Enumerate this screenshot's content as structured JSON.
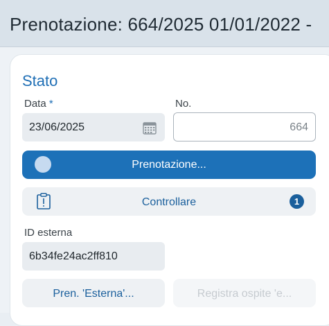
{
  "window": {
    "title": "Prenotazione: 664/2025 01/01/2022 -"
  },
  "section": {
    "title": "Stato"
  },
  "date": {
    "label": "Data",
    "required_mark": "*",
    "value": "23/06/2025",
    "icon": "calendar-icon"
  },
  "number": {
    "label": "No.",
    "value": "664"
  },
  "status_button": {
    "label": "Prenotazione..."
  },
  "check_button": {
    "label": "Controllare",
    "badge": "1",
    "icon": "clipboard-alert-icon"
  },
  "external_id": {
    "label": "ID esterna",
    "value": "6b34fe24ac2ff810"
  },
  "actions": {
    "external_booking": "Pren. 'Esterna'...",
    "register_guest": "Registra ospite 'e..."
  },
  "colors": {
    "accent": "#1d71b8",
    "title": "#1e6eb5",
    "link": "#1a5f9c"
  }
}
